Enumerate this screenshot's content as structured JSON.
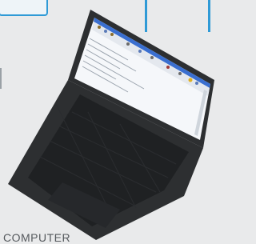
{
  "caption": "COMPUTER",
  "illustration": {
    "subject": "laptop-icon",
    "screen_app": "text-editor-window"
  },
  "colors": {
    "background": "#e9eaeb",
    "accent": "#2f9ad6",
    "laptop_body": "#2d2f31",
    "keyboard": "#1f2123",
    "screen_bg": "#f5f7fa",
    "window_title": "#3a6fd0",
    "caption_text": "#55595d"
  }
}
